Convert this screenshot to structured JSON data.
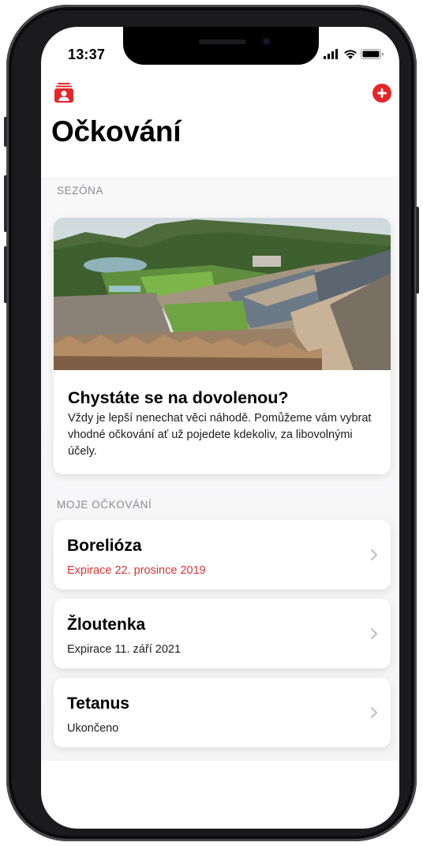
{
  "status_bar": {
    "time": "13:37"
  },
  "header": {
    "title": "Očkování",
    "profile_icon": "person-card-icon",
    "add_icon": "plus-circle-icon",
    "accent_color": "#e8242b"
  },
  "season": {
    "label": "SEZÓNA",
    "card": {
      "image": "resort-landscape-photo",
      "title": "Chystáte se na dovolenou?",
      "description": "Vždy je lepší nenechat věci náhodě. Pomůžeme vám vybrat vhodné očkování ať už pojedete kdekoliv, za libovolnými účely."
    }
  },
  "my_vaccinations": {
    "label": "MOJE OČKOVÁNÍ",
    "items": [
      {
        "name": "Borelióza",
        "status": "Expirace 22. prosince 2019",
        "status_color": "#e5312f"
      },
      {
        "name": "Žloutenka",
        "status": "Expirace 11. září 2021",
        "status_color": "#1c1c1e"
      },
      {
        "name": "Tetanus",
        "status": "Ukončeno",
        "status_color": "#1c1c1e"
      }
    ]
  }
}
